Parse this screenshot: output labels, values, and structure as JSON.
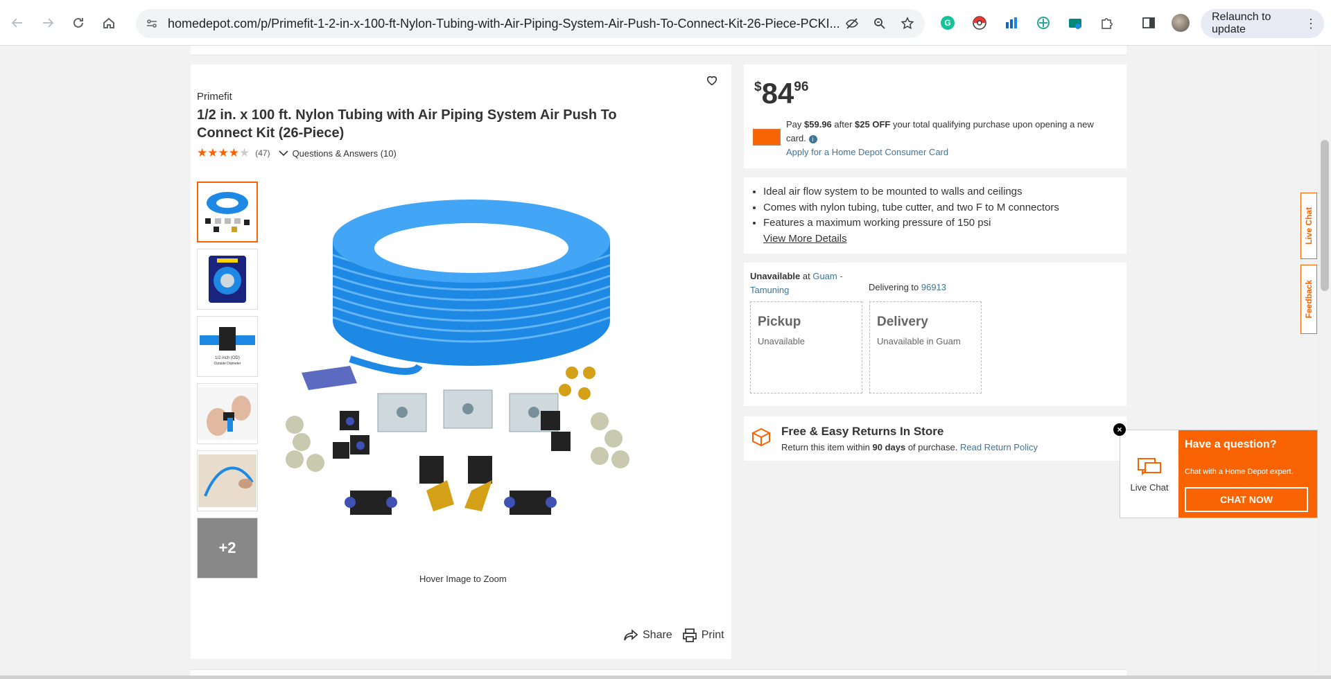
{
  "browser": {
    "url": "homedepot.com/p/Primefit-1-2-in-x-100-ft-Nylon-Tubing-with-Air-Piping-System-Air-Push-To-Connect-Kit-26-Piece-PCKI...",
    "relaunch_label": "Relaunch to update"
  },
  "product": {
    "brand": "Primefit",
    "title": "1/2 in. x 100 ft. Nylon Tubing with Air Piping System Air Push To Connect Kit (26-Piece)",
    "rating_stars": 4,
    "review_count": "(47)",
    "qa_label": "Questions & Answers (10)",
    "thumbnail_more": "+2",
    "hover_zoom": "Hover Image to Zoom",
    "share_label": "Share",
    "print_label": "Print"
  },
  "price": {
    "dollar": "$",
    "whole": "84",
    "cents": "96",
    "promo_pre": "Pay ",
    "promo_amount": "$59.96",
    "promo_after": " after ",
    "promo_off": "$25 OFF",
    "promo_rest": " your total qualifying purchase upon opening a new card.",
    "apply_link": "Apply for a Home Depot Consumer Card"
  },
  "highlights": [
    "Ideal air flow system to be mounted to walls and ceilings",
    "Comes with nylon tubing, tube cutter, and two F to M connectors",
    "Features a maximum working pressure of 150 psi"
  ],
  "view_more": "View More Details",
  "fulfillment": {
    "unavailable_label": "Unavailable",
    "at_text": " at ",
    "store": "Guam - Tamuning",
    "delivering_to": "Delivering to ",
    "zip": "96913",
    "pickup_title": "Pickup",
    "pickup_status": "Unavailable",
    "delivery_title": "Delivery",
    "delivery_status": "Unavailable in Guam"
  },
  "returns": {
    "title": "Free & Easy Returns In Store",
    "pre": "Return this item within ",
    "days": "90 days",
    "post": " of purchase. ",
    "link": "Read Return Policy"
  },
  "chat": {
    "live_chat": "Live Chat",
    "question": "Have a question?",
    "sub": "Chat with a Home Depot expert.",
    "button": "CHAT NOW",
    "close": "×"
  },
  "side_tabs": {
    "live_chat": "Live Chat",
    "feedback": "Feedback"
  },
  "colors": {
    "brand_orange": "#f96302",
    "link_blue": "#3e7697"
  }
}
